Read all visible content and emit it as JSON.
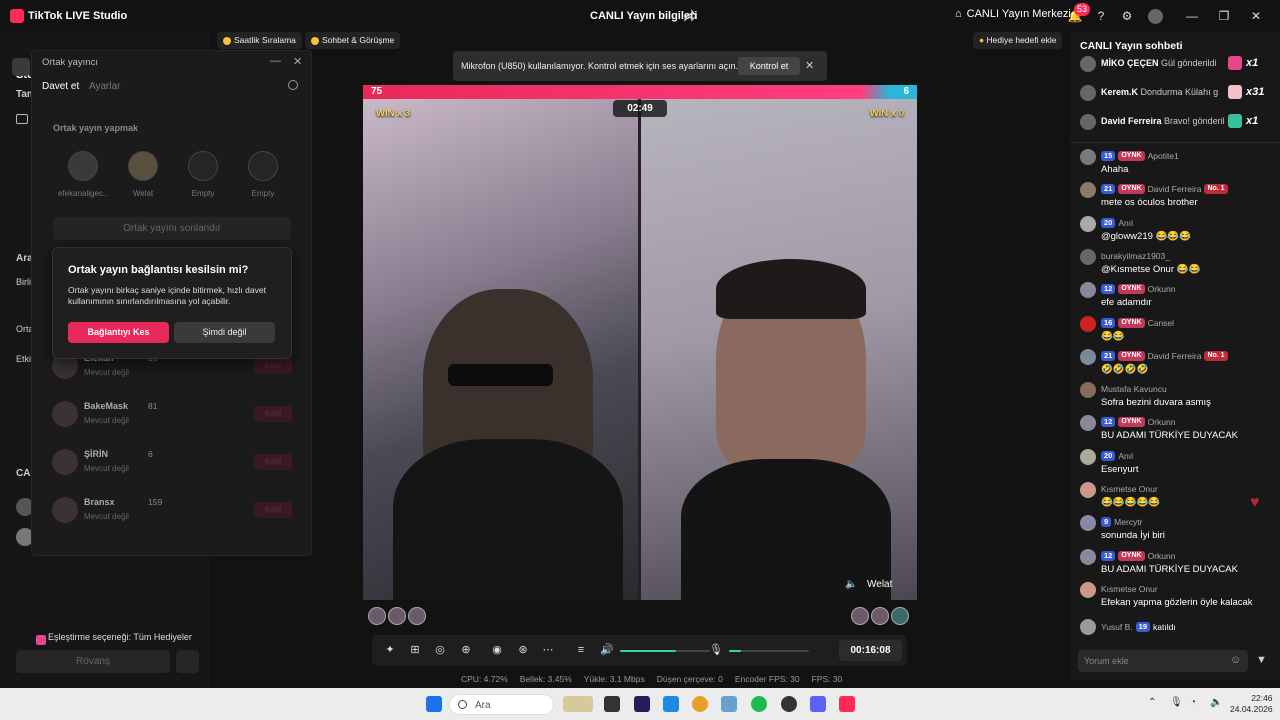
{
  "titlebar": {
    "app_title": "TikTok LIVE Studio",
    "center_title": "CANLI Yayın bilgileri",
    "live_center": "CANLI Yayın Merkezi",
    "notifications": "53"
  },
  "left": {
    "studio_view": "Studio görünümü",
    "partial_labels": [
      "Tam",
      "Ara",
      "Birli",
      "Orta",
      "Etki",
      "CAN"
    ],
    "match_option": "Eşleştirme seçeneği: Tüm Hediyeler",
    "revenge": "Rövanş"
  },
  "chips": {
    "hourly": "Saatlik Sıralama",
    "chat_match": "Sohbet & Görüşme",
    "gift_goal": "Hediye hedefi ekle"
  },
  "cohost": {
    "title": "Ortak yayıncı",
    "tab_invite": "Davet et",
    "tab_settings": "Ayarlar",
    "section": "Ortak yayın yapmak",
    "slots": [
      "efekanaligec...",
      "Welat",
      "Empty",
      "Empty"
    ],
    "end_button": "Ortak yayını sonlandır",
    "members": [
      {
        "name": "Efekan",
        "count": "16",
        "status": "Mevcut değil",
        "action": "Katıl"
      },
      {
        "name": "BakeMask",
        "count": "81",
        "status": "Mevcut değil",
        "action": "Katıl"
      },
      {
        "name": "ŞİRİN",
        "count": "6",
        "status": "Mevcut değil",
        "action": "Katıl"
      },
      {
        "name": "Bransx",
        "count": "159",
        "status": "Mevcut değil",
        "action": "Katıl"
      }
    ]
  },
  "dialog": {
    "title": "Ortak yayın bağlantısı kesilsin mi?",
    "body": "Ortak yayını birkaç saniye içinde bitirmek, hızlı davet kullanımının sınırlandırılmasına yol açabilir.",
    "confirm": "Bağlantıyı Kes",
    "cancel": "Şimdi değil"
  },
  "toast": {
    "text": "Mikrofon (U850) kullanılamıyor. Kontrol etmek için ses ayarlarını açın.",
    "action": "Kontrol et"
  },
  "battle": {
    "score_left": "75",
    "score_right": "6",
    "timer": "02:49",
    "win_left": "WIN x 3",
    "win_right": "WIN x 0",
    "right_name": "Welat"
  },
  "controls": {
    "live_time": "00:16:08",
    "volume": 0.62,
    "mic": 0.15
  },
  "stats": {
    "cpu": "CPU: 4.72%",
    "memory": "Bellek: 3.45%",
    "upload": "Yükle: 3.1 Mbps",
    "dropped": "Düşen çerçeve: 0",
    "encoder": "Encoder FPS: 30",
    "fps": "FPS: 30"
  },
  "chat": {
    "title": "CANLI Yayın sohbeti",
    "gifts": [
      {
        "user": "MİKO ÇEÇEN",
        "text": "Gül gönderildi",
        "mult": "x1",
        "color": "#e8468a"
      },
      {
        "user": "Kerem.K",
        "text": "Dondurma Külahı g",
        "mult": "x31",
        "color": "#f2c2c8"
      },
      {
        "user": "David Ferreira",
        "text": "Bravo! gönderil",
        "mult": "x1",
        "color": "#35c29a"
      }
    ],
    "messages": [
      {
        "level": "15",
        "fan": "OYNK",
        "user": "Apotite1",
        "no1": "",
        "text": "Ahaha"
      },
      {
        "level": "21",
        "fan": "OYNK",
        "user": "David Ferreira",
        "no1": "No. 1",
        "text": "mete os óculos brother"
      },
      {
        "level": "20",
        "fan": "",
        "user": "Anıl",
        "no1": "",
        "text": "@gloww219 😂😂😂"
      },
      {
        "level": "",
        "fan": "",
        "user": "burakyilmaz1903_",
        "no1": "",
        "text": "@Kısmetse Onur 😂😂"
      },
      {
        "level": "12",
        "fan": "OYNK",
        "user": "Orkunn",
        "no1": "",
        "text": "efe adamdır"
      },
      {
        "level": "16",
        "fan": "OYNK",
        "user": "Cansel",
        "no1": "",
        "text": "😂😂"
      },
      {
        "level": "21",
        "fan": "OYNK",
        "user": "David Ferreira",
        "no1": "No. 1",
        "text": "🤣🤣🤣🤣"
      },
      {
        "level": "",
        "fan": "",
        "user": "Mustafa Kavuncu",
        "no1": "",
        "text": "Sofra bezini duvara asmış"
      },
      {
        "level": "12",
        "fan": "OYNK",
        "user": "Orkunn",
        "no1": "",
        "text": "BU ADAMI TÜRKİYE DUYACAK"
      },
      {
        "level": "20",
        "fan": "",
        "user": "Anıl",
        "no1": "",
        "text": "Esenyurt"
      },
      {
        "level": "",
        "fan": "",
        "user": "Kısmetse Onur",
        "no1": "",
        "text": "😂😂😂😂😂"
      },
      {
        "level": "9",
        "fan": "",
        "user": "Mercytr",
        "no1": "",
        "text": "sonunda İyi biri"
      },
      {
        "level": "12",
        "fan": "OYNK",
        "user": "Orkunn",
        "no1": "",
        "text": "BU ADAMI TÜRKİYE DUYACAK"
      },
      {
        "level": "",
        "fan": "",
        "user": "Kısmetse Onur",
        "no1": "",
        "text": "Efekan yapma gözlerin öyle kalacak"
      }
    ],
    "joined": {
      "user": "Yusuf B.",
      "level": "19",
      "text": "katıldı"
    },
    "input_placeholder": "Yorum ekle"
  },
  "taskbar": {
    "search": "Ara",
    "time": "22:46",
    "date": "24.04.2026"
  }
}
